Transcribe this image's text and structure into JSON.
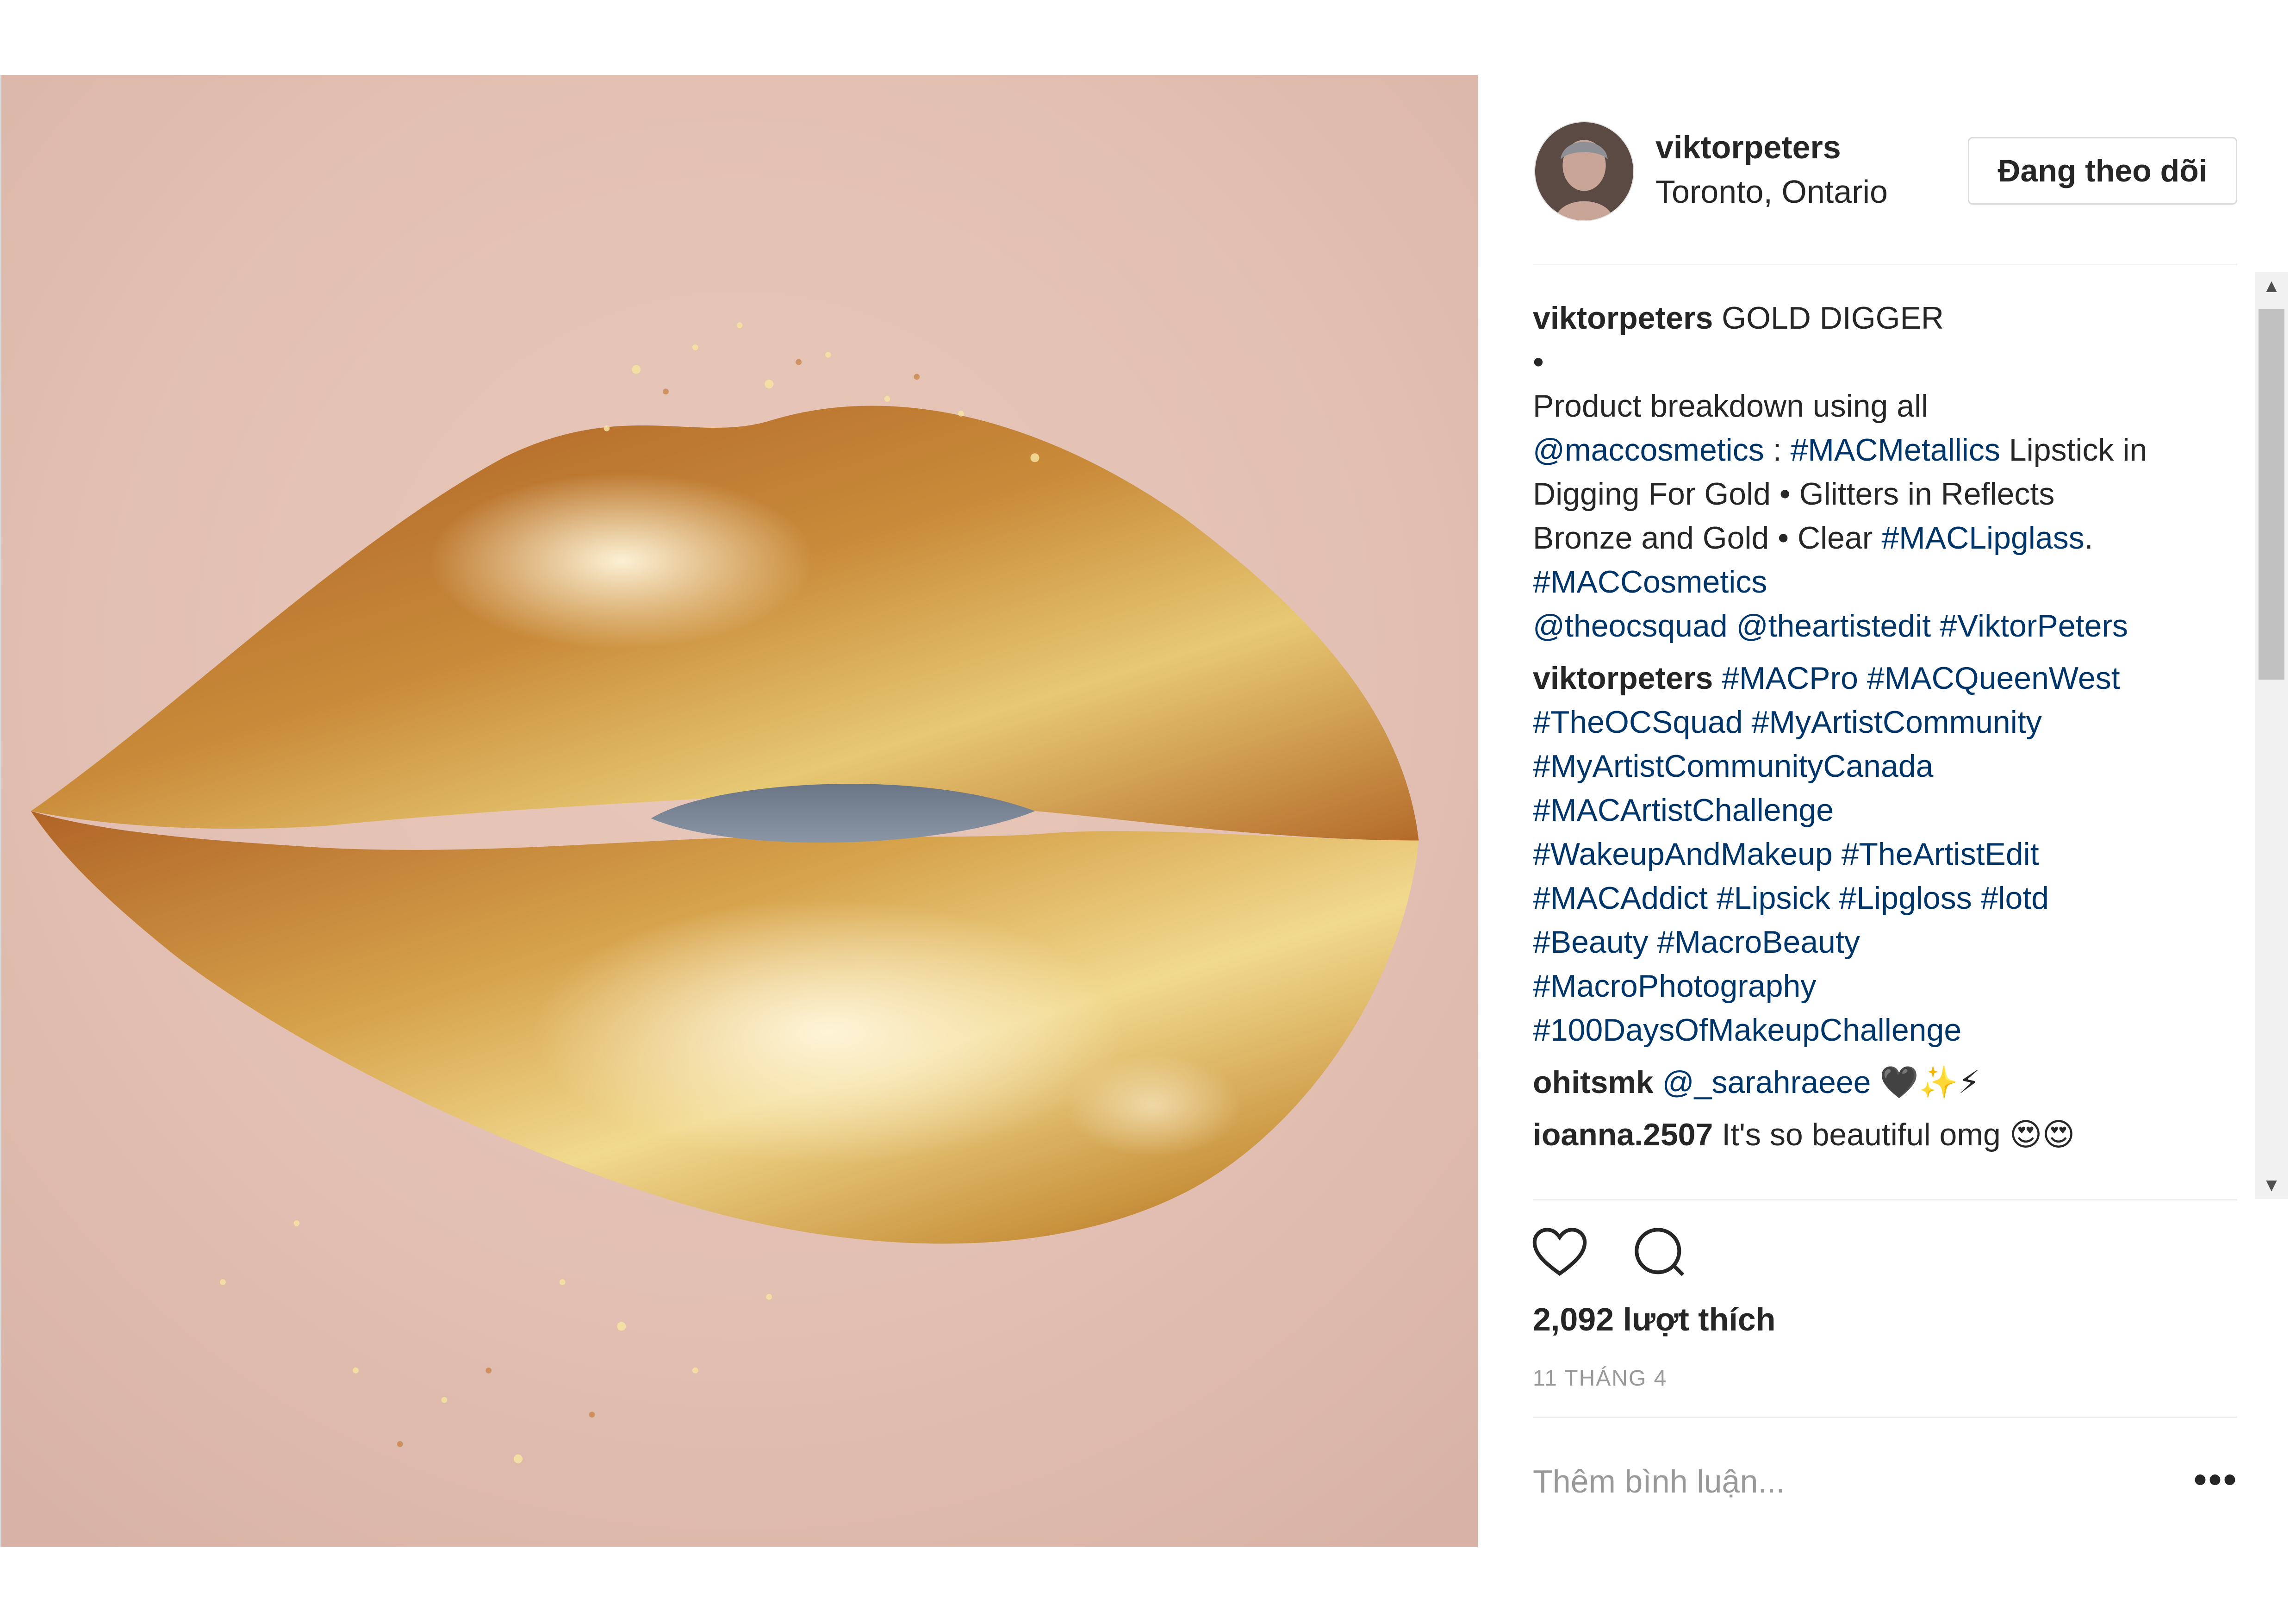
{
  "post": {
    "image_alt_icon": "gold-glitter-lips-photo"
  },
  "header": {
    "username": "viktorpeters",
    "location": "Toronto, Ontario",
    "follow_label": "Đang theo dõi"
  },
  "comments": [
    {
      "user": "viktorpeters",
      "segments": [
        {
          "text": " GOLD DIGGER\n•\nProduct breakdown using all\n",
          "link": false
        },
        {
          "text": "@maccosmetics",
          "link": true
        },
        {
          "text": " : ",
          "link": false
        },
        {
          "text": "#MACMetallics",
          "link": true
        },
        {
          "text": " Lipstick in\nDigging For Gold • Glitters in Reflects\nBronze and Gold • Clear ",
          "link": false
        },
        {
          "text": "#MACLipglass",
          "link": true
        },
        {
          "text": ".\n",
          "link": false
        },
        {
          "text": "#MACCosmetics",
          "link": true
        },
        {
          "text": "\n",
          "link": false
        },
        {
          "text": "@theocsquad",
          "link": true
        },
        {
          "text": " ",
          "link": false
        },
        {
          "text": "@theartistedit",
          "link": true
        },
        {
          "text": " ",
          "link": false
        },
        {
          "text": "#ViktorPeters",
          "link": true
        }
      ]
    },
    {
      "user": "viktorpeters",
      "segments": [
        {
          "text": " ",
          "link": false
        },
        {
          "text": "#MACPro",
          "link": true
        },
        {
          "text": " ",
          "link": false
        },
        {
          "text": "#MACQueenWest",
          "link": true
        },
        {
          "text": "\n",
          "link": false
        },
        {
          "text": "#TheOCSquad",
          "link": true
        },
        {
          "text": " ",
          "link": false
        },
        {
          "text": "#MyArtistCommunity",
          "link": true
        },
        {
          "text": "\n",
          "link": false
        },
        {
          "text": "#MyArtistCommunityCanada",
          "link": true
        },
        {
          "text": "\n",
          "link": false
        },
        {
          "text": "#MACArtistChallenge",
          "link": true
        },
        {
          "text": "\n",
          "link": false
        },
        {
          "text": "#WakeupAndMakeup",
          "link": true
        },
        {
          "text": " ",
          "link": false
        },
        {
          "text": "#TheArtistEdit",
          "link": true
        },
        {
          "text": "\n",
          "link": false
        },
        {
          "text": "#MACAddict",
          "link": true
        },
        {
          "text": " ",
          "link": false
        },
        {
          "text": "#Lipsick",
          "link": true
        },
        {
          "text": " ",
          "link": false
        },
        {
          "text": "#Lipgloss",
          "link": true
        },
        {
          "text": " ",
          "link": false
        },
        {
          "text": "#lotd",
          "link": true
        },
        {
          "text": "\n",
          "link": false
        },
        {
          "text": "#Beauty",
          "link": true
        },
        {
          "text": " ",
          "link": false
        },
        {
          "text": "#MacroBeauty",
          "link": true
        },
        {
          "text": "\n",
          "link": false
        },
        {
          "text": "#MacroPhotography",
          "link": true
        },
        {
          "text": "\n",
          "link": false
        },
        {
          "text": "#100DaysOfMakeupChallenge",
          "link": true
        }
      ]
    },
    {
      "user": "ohitsmk",
      "segments": [
        {
          "text": " ",
          "link": false
        },
        {
          "text": "@_sarahraeee",
          "link": true
        },
        {
          "text": " 🖤✨⚡",
          "link": false
        }
      ]
    },
    {
      "user": "ioanna.2507",
      "segments": [
        {
          "text": " It's so beautiful omg 😍😍",
          "link": false
        }
      ]
    }
  ],
  "actions": {
    "like_icon": "heart-icon",
    "comment_icon": "comment-bubble-icon"
  },
  "likes_text": "2,092 lượt thích",
  "date_text": "11 THÁNG 4",
  "add_comment_placeholder": "Thêm bình luận...",
  "more_label": "•••",
  "colors": {
    "link": "#003569",
    "text": "#262626",
    "muted": "#999999",
    "border": "#efefef"
  }
}
